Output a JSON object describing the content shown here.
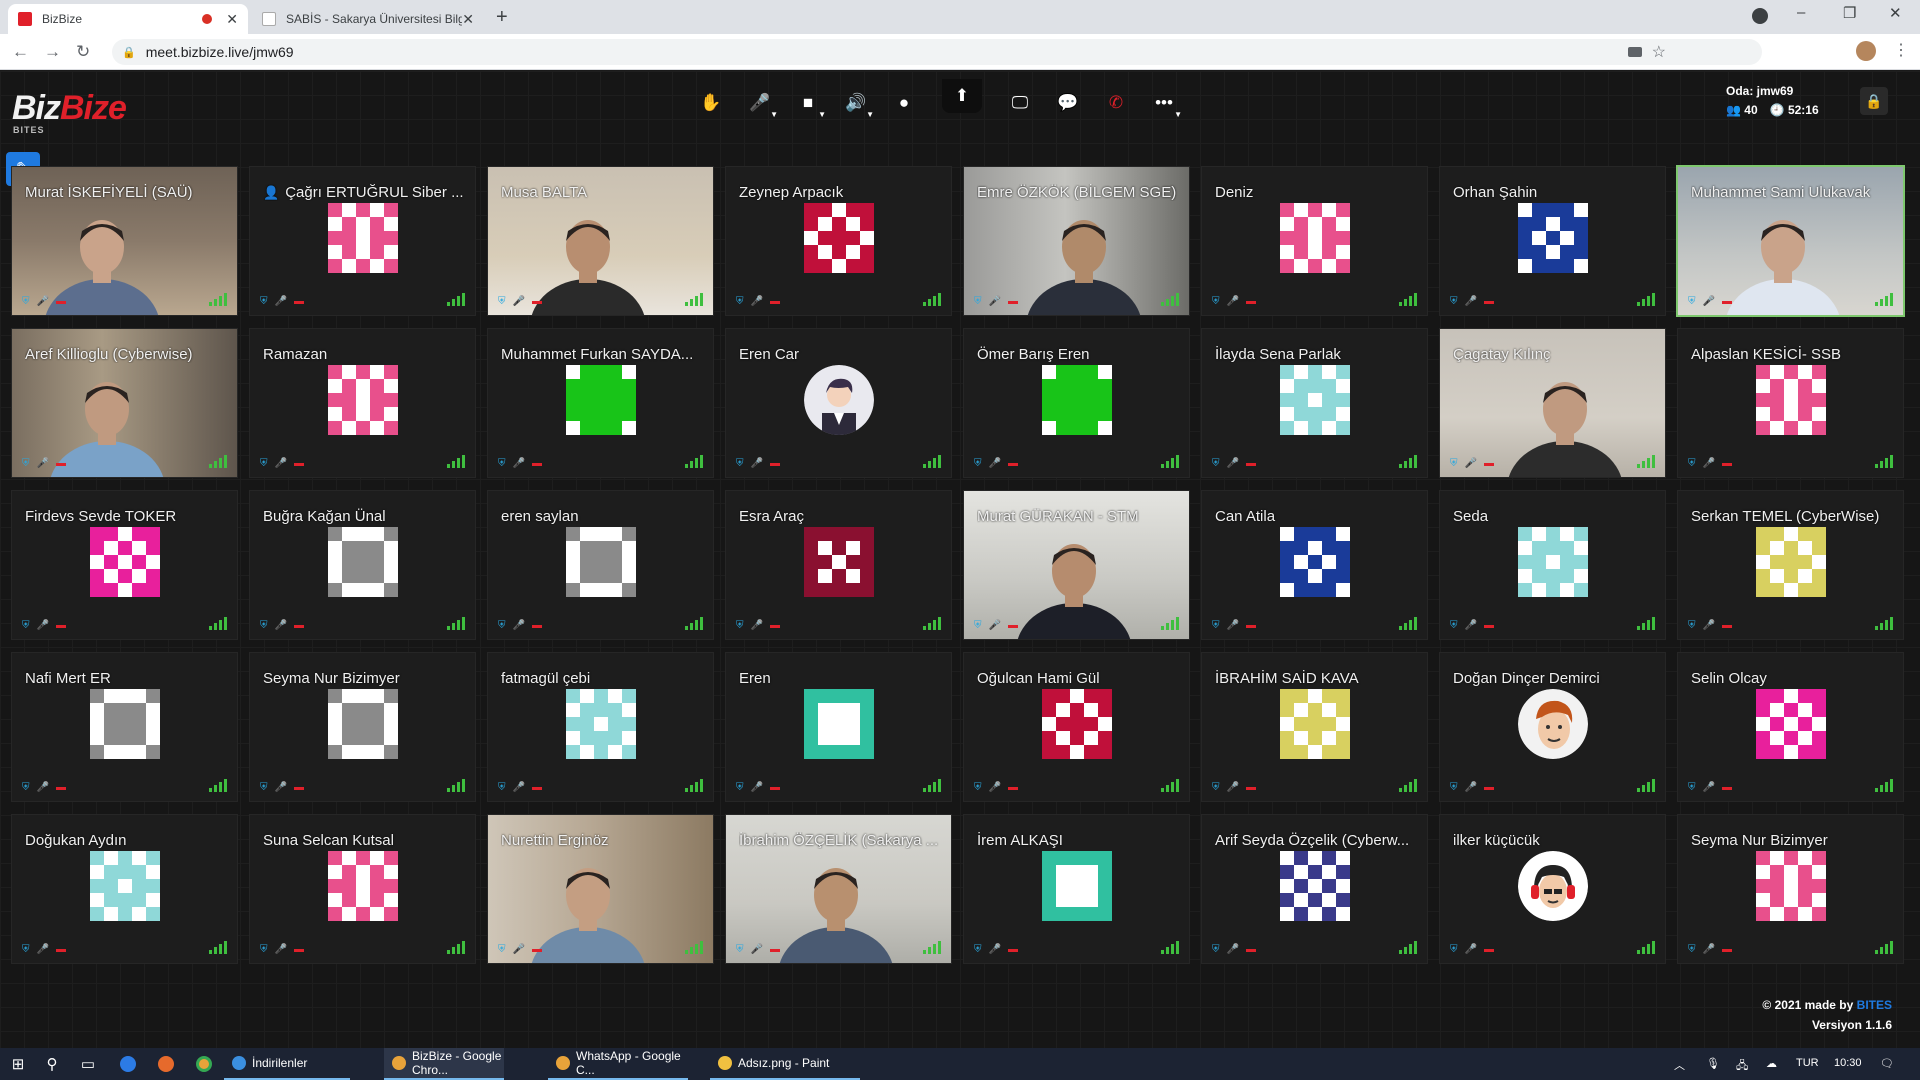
{
  "browser": {
    "tabs": [
      {
        "title": "BizBize",
        "active": true
      },
      {
        "title": "SABİS - Sakarya Üniversitesi Bilgi",
        "active": false
      }
    ],
    "url": "meet.bizbize.live/jmw69",
    "new_tab": "+",
    "win_min": "–",
    "win_max": "❐",
    "win_close": "✕"
  },
  "app": {
    "logo_part1": "Biz",
    "logo_part2": "Bize",
    "logo_sub": "BITES",
    "room_label": "Oda: jmw69",
    "participants": "40",
    "timer": "52:16",
    "credit_text": "© 2021 made by ",
    "credit_brand": "BITES",
    "version": "Versiyon 1.1.6",
    "brand_red": "#e0202a",
    "accent_blue": "#1f7ae0"
  },
  "toolbar": [
    {
      "name": "raise-hand",
      "icon": "✋",
      "red": false
    },
    {
      "name": "mic-muted",
      "icon": "🎤",
      "red": true,
      "caret": true
    },
    {
      "name": "camera",
      "icon": "■",
      "red": false,
      "caret": true
    },
    {
      "name": "speaker",
      "icon": "🔊",
      "red": false,
      "caret": true
    },
    {
      "name": "record",
      "icon": "●",
      "red": false
    },
    {
      "name": "share-screen",
      "icon": "🖵",
      "red": false
    },
    {
      "name": "chat",
      "icon": "💬",
      "red": false
    },
    {
      "name": "hang-up",
      "icon": "✆",
      "red": true
    },
    {
      "name": "more",
      "icon": "•••",
      "red": false,
      "caret": true
    }
  ],
  "participants": [
    {
      "name": "Murat İSKEFİYELİ (SAÜ)",
      "type": "video",
      "scene": "office"
    },
    {
      "name": "Çağrı ERTUĞRUL Siber ...",
      "type": "avatar",
      "pattern": "pinkTri",
      "moderator": true
    },
    {
      "name": "Musa BALTA",
      "type": "video",
      "scene": "light"
    },
    {
      "name": "Zeynep Arpacık",
      "type": "avatar",
      "pattern": "redStar"
    },
    {
      "name": "Emre ÖZKÖK (BİLGEM SGE)",
      "type": "video",
      "scene": "room"
    },
    {
      "name": "Deniz",
      "type": "avatar",
      "pattern": "pinkTri"
    },
    {
      "name": "Orhan Şahin",
      "type": "avatar",
      "pattern": "blueDiamond"
    },
    {
      "name": "Muhammet Sami Ulukavak",
      "type": "video",
      "scene": "office2",
      "speaking": true
    },
    {
      "name": "Aref Killioglu (Cyberwise)",
      "type": "video",
      "scene": "lamps"
    },
    {
      "name": "Ramazan",
      "type": "avatar",
      "pattern": "pinkTri"
    },
    {
      "name": "Muhammet Furkan SAYDA...",
      "type": "avatar",
      "pattern": "greenCross"
    },
    {
      "name": "Eren Car",
      "type": "person",
      "pattern": "man"
    },
    {
      "name": "Ömer Barış Eren",
      "type": "avatar",
      "pattern": "greenCross"
    },
    {
      "name": "İlayda Sena Parlak",
      "type": "avatar",
      "pattern": "cyanDiamond"
    },
    {
      "name": "Çagatay Kılınç",
      "type": "video",
      "scene": "dim"
    },
    {
      "name": "Alpaslan KESİCİ- SSB",
      "type": "avatar",
      "pattern": "pinkTri"
    },
    {
      "name": "Firdevs Sevde TOKER",
      "type": "avatar",
      "pattern": "magentaX"
    },
    {
      "name": "Buğra Kağan Ünal",
      "type": "avatar",
      "pattern": "greyBlock"
    },
    {
      "name": "eren saylan",
      "type": "avatar",
      "pattern": "greyBlock"
    },
    {
      "name": "Esra Araç",
      "type": "avatar",
      "pattern": "maroonDots"
    },
    {
      "name": "Murat GÜRAKAN - STM",
      "type": "video",
      "scene": "bright"
    },
    {
      "name": "Can Atila",
      "type": "avatar",
      "pattern": "blueDiamond"
    },
    {
      "name": "Seda",
      "type": "avatar",
      "pattern": "cyanDiamond"
    },
    {
      "name": "Serkan TEMEL (CyberWise)",
      "type": "avatar",
      "pattern": "yellowGrid"
    },
    {
      "name": "Nafi Mert ER",
      "type": "avatar",
      "pattern": "greyBlock"
    },
    {
      "name": "Seyma Nur Bizimyer",
      "type": "avatar",
      "pattern": "greyBlock"
    },
    {
      "name": "fatmagül çebi",
      "type": "avatar",
      "pattern": "cyanDiamond"
    },
    {
      "name": "Eren",
      "type": "avatar",
      "pattern": "tealFrame"
    },
    {
      "name": "Oğulcan Hami Gül",
      "type": "avatar",
      "pattern": "redStar"
    },
    {
      "name": "İBRAHİM SAİD KAVA",
      "type": "avatar",
      "pattern": "yellowGrid"
    },
    {
      "name": "Doğan Dinçer Demirci",
      "type": "person",
      "pattern": "cartoon"
    },
    {
      "name": "Selin Olcay",
      "type": "avatar",
      "pattern": "magentaX"
    },
    {
      "name": "Doğukan Aydın",
      "type": "avatar",
      "pattern": "cyanDiamond"
    },
    {
      "name": "Suna Selcan Kutsal",
      "type": "avatar",
      "pattern": "pinkTri"
    },
    {
      "name": "Nurettin Erginöz",
      "type": "video",
      "scene": "books"
    },
    {
      "name": "İbrahim ÖZÇELİK (Sakarya ...",
      "type": "video",
      "scene": "wall"
    },
    {
      "name": "İrem ALKAŞI",
      "type": "avatar",
      "pattern": "tealFrame"
    },
    {
      "name": "Arif Seyda Özçelik (Cyberw...",
      "type": "avatar",
      "pattern": "navyDots"
    },
    {
      "name": "ilker küçücük",
      "type": "person",
      "pattern": "headphones"
    },
    {
      "name": "Seyma Nur Bizimyer",
      "type": "avatar",
      "pattern": "pinkTri"
    }
  ],
  "taskbar": {
    "apps": [
      {
        "label": "İndirilenler",
        "color": "#3b8fe0",
        "open": true,
        "focus": false
      },
      {
        "label": "BizBize - Google Chro...",
        "color": "#e8a33a",
        "open": true,
        "focus": true
      },
      {
        "label": "WhatsApp - Google C...",
        "color": "#e8a33a",
        "open": true,
        "focus": false
      },
      {
        "label": "Adsız.png - Paint",
        "color": "#f0c040",
        "open": true,
        "focus": false
      }
    ],
    "lang": "TUR",
    "time": "10:30"
  }
}
